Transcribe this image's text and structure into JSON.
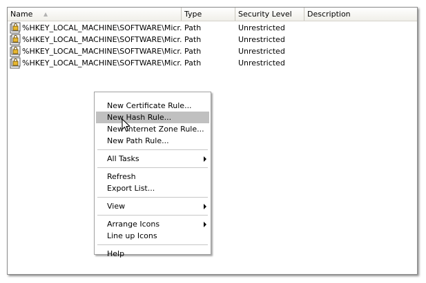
{
  "columns": {
    "name": "Name",
    "type": "Type",
    "security_level": "Security Level",
    "description": "Description"
  },
  "rows": [
    {
      "name": "%HKEY_LOCAL_MACHINE\\SOFTWARE\\Micr...",
      "type": "Path",
      "security_level": "Unrestricted",
      "description": "",
      "icon": "registry-rule-icon"
    },
    {
      "name": "%HKEY_LOCAL_MACHINE\\SOFTWARE\\Micr...",
      "type": "Path",
      "security_level": "Unrestricted",
      "description": "",
      "icon": "registry-rule-icon"
    },
    {
      "name": "%HKEY_LOCAL_MACHINE\\SOFTWARE\\Micr...",
      "type": "Path",
      "security_level": "Unrestricted",
      "description": "",
      "icon": "registry-rule-icon"
    },
    {
      "name": "%HKEY_LOCAL_MACHINE\\SOFTWARE\\Micr...",
      "type": "Path",
      "security_level": "Unrestricted",
      "description": "",
      "icon": "registry-rule-icon"
    }
  ],
  "context_menu": {
    "new_certificate_rule": "New Certificate Rule...",
    "new_hash_rule": "New Hash Rule...",
    "new_internet_zone_rule": "New Internet Zone Rule...",
    "new_path_rule": "New Path Rule...",
    "all_tasks": "All Tasks",
    "refresh": "Refresh",
    "export_list": "Export List...",
    "view": "View",
    "arrange_icons": "Arrange Icons",
    "line_up_icons": "Line up Icons",
    "help": "Help",
    "highlighted_item": "new_hash_rule"
  },
  "colors": {
    "highlight": "#c0c0c0",
    "icon_gold": "#e8b830"
  }
}
